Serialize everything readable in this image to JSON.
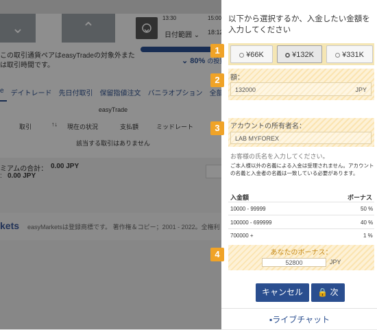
{
  "background": {
    "time1": "13:30",
    "time2": "15:00",
    "date_range": "日付範囲",
    "time3": "18:12",
    "notice_line1": "この取引通貨ペアはeasyTradeの対象外また",
    "notice_line2": "は取引時間です。",
    "progress_text": "80%",
    "progress_suffix": "の投資",
    "tabs": [
      "デイトレード",
      "先日付取引",
      "保留指値注文",
      "バニラオプション",
      "全部見る"
    ],
    "table_title": "easyTrade",
    "columns": [
      "取引",
      "現在の状況",
      "支払額",
      "ミッドレート"
    ],
    "no_trades": "該当する取引はありません",
    "premium_total_label": "ミアムの合計：",
    "premium_total_value": "0.00 JPY",
    "premium_line2_value": "0.00 JPY",
    "footer_logo": "kets",
    "footer_text": "easyMarketsは登録商標です。 著作権＆コピー；2001 - 2022。全権利"
  },
  "modal": {
    "instruction": "以下から選択するか、入金したい金額を入力してください",
    "amount_options": [
      {
        "label": "¥66K",
        "selected": false
      },
      {
        "label": "¥132K",
        "selected": true
      },
      {
        "label": "¥331K",
        "selected": false
      }
    ],
    "amount_label": "額：",
    "amount_value": "132000",
    "amount_currency": "JPY",
    "holder_label": "アカウントの所有者名：",
    "holder_value": "LAB MYFOREX",
    "holder_hint": "お客様の氏名を入力してください。",
    "holder_note": "ご本人様以外の名義による入金は受理されません。アカウントの名義と入金者の名義は一致している必要があります。",
    "bonus_table": {
      "col1": "入金額",
      "col2": "ボーナス",
      "rows": [
        {
          "range": "10000 - 99999",
          "pct": "50 %"
        },
        {
          "range": "100000 - 699999",
          "pct": "40 %"
        },
        {
          "range": "700000 +",
          "pct": "1 %"
        }
      ]
    },
    "bonus_label": "あなたのボーナス：",
    "bonus_value": "52800",
    "bonus_currency": "JPY",
    "cancel_button": "キャンセル",
    "next_button": "次",
    "live_chat": "ライブチャット"
  },
  "badges": [
    "1",
    "2",
    "3",
    "4"
  ],
  "colors": {
    "primary_blue": "#2a4e8f",
    "highlight_orange": "#f0a327",
    "highlight_fill": "#fbe4b0"
  }
}
